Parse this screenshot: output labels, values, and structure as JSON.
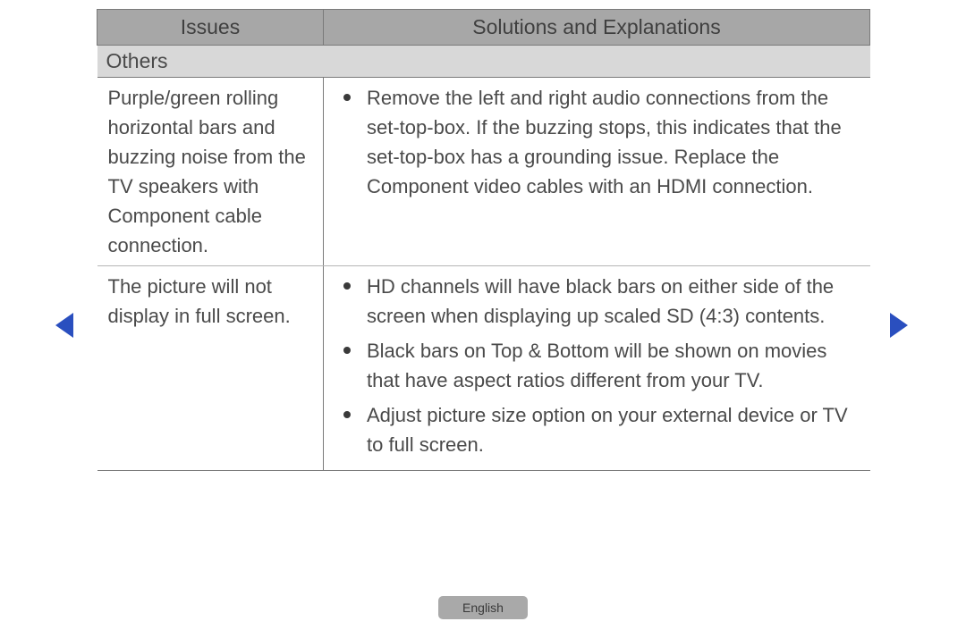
{
  "headers": {
    "issues": "Issues",
    "solutions": "Solutions and Explanations"
  },
  "section": "Others",
  "rows": [
    {
      "issue": "Purple/green rolling horizontal bars and buzzing noise from the TV speakers with Component cable connection.",
      "solutions": [
        "Remove the left and right audio connections from the set-top-box. If the buzzing stops, this indicates that the set-top-box has a grounding issue. Replace the Component video cables with an HDMI connection."
      ]
    },
    {
      "issue": "The picture will not display in full screen.",
      "solutions": [
        "HD channels will have black bars on either side of the screen when displaying up scaled SD (4:3) contents.",
        "Black bars on Top & Bottom will be shown on movies that have aspect ratios different from your TV.",
        "Adjust picture size option on your external device or TV to full screen."
      ]
    }
  ],
  "language": "English"
}
